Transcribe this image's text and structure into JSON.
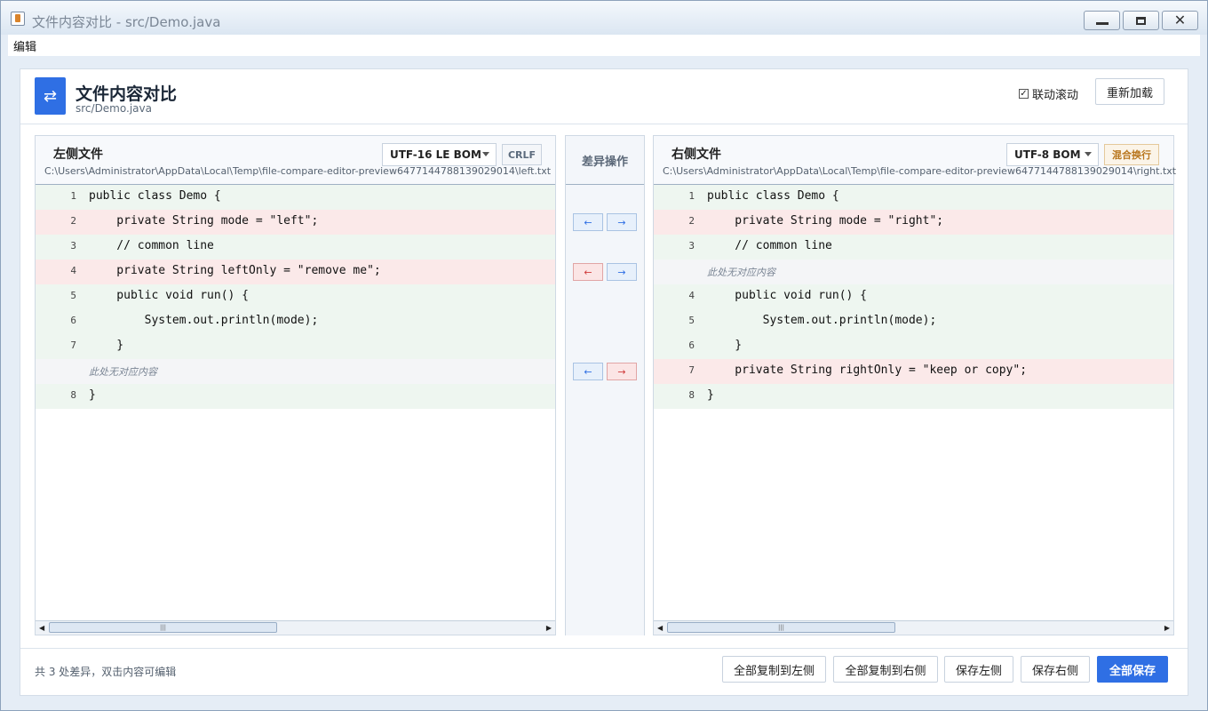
{
  "window": {
    "title": "文件内容对比 - src/Demo.java"
  },
  "menu": {
    "edit": "编辑"
  },
  "header": {
    "icon": "swap-arrows-icon",
    "title": "文件内容对比",
    "subtitle": "src/Demo.java",
    "sync_scroll_label": "联动滚动",
    "sync_scroll_checked": true,
    "reload_label": "重新加载",
    "accent_color": "#2f6fe4"
  },
  "left": {
    "title": "左侧文件",
    "path": "C:\\Users\\Administrator\\AppData\\Local\\Temp\\file-compare-editor-preview6477144788139029014\\left.txt",
    "encoding": "UTF-16 LE BOM",
    "line_ending": "CRLF",
    "lines": [
      {
        "type": "eq",
        "num": "1",
        "text": "public class Demo {"
      },
      {
        "type": "diff",
        "num": "2",
        "text": "    private String mode = \"left\";"
      },
      {
        "type": "eq",
        "num": "3",
        "text": "    // common line"
      },
      {
        "type": "diff",
        "num": "4",
        "text": "    private String leftOnly = \"remove me\";"
      },
      {
        "type": "eq",
        "num": "5",
        "text": "    public void run() {"
      },
      {
        "type": "eq",
        "num": "6",
        "text": "        System.out.println(mode);"
      },
      {
        "type": "eq",
        "num": "7",
        "text": "    }"
      },
      {
        "type": "gap",
        "num": "",
        "text": "此处无对应内容"
      },
      {
        "type": "eq",
        "num": "8",
        "text": "}"
      }
    ]
  },
  "right": {
    "title": "右侧文件",
    "path": "C:\\Users\\Administrator\\AppData\\Local\\Temp\\file-compare-editor-preview6477144788139029014\\right.txt",
    "encoding": "UTF-8 BOM",
    "line_ending": "混合换行",
    "lines": [
      {
        "type": "eq",
        "num": "1",
        "text": "public class Demo {"
      },
      {
        "type": "diff",
        "num": "2",
        "text": "    private String mode = \"right\";"
      },
      {
        "type": "eq",
        "num": "3",
        "text": "    // common line"
      },
      {
        "type": "gap",
        "num": "",
        "text": "此处无对应内容"
      },
      {
        "type": "eq",
        "num": "4",
        "text": "    public void run() {"
      },
      {
        "type": "eq",
        "num": "5",
        "text": "        System.out.println(mode);"
      },
      {
        "type": "eq",
        "num": "6",
        "text": "    }"
      },
      {
        "type": "diff",
        "num": "7",
        "text": "    private String rightOnly = \"keep or copy\";"
      },
      {
        "type": "eq",
        "num": "8",
        "text": "}"
      }
    ]
  },
  "middle": {
    "title": "差异操作",
    "arrow_left": "←",
    "arrow_right": "→",
    "actions": [
      {
        "row": 1,
        "left_highlight": false,
        "right_highlight": false
      },
      {
        "row": 3,
        "left_highlight": true,
        "right_highlight": false
      },
      {
        "row": 7,
        "left_highlight": false,
        "right_highlight": true
      }
    ]
  },
  "footer": {
    "status": "共 3 处差异，双击内容可编辑",
    "copy_all_left": "全部复制到左侧",
    "copy_all_right": "全部复制到右侧",
    "save_left": "保存左侧",
    "save_right": "保存右侧",
    "save_all": "全部保存"
  },
  "colors": {
    "equal_bg": "#eef6f0",
    "diff_bg": "#fbe9e9",
    "gap_bg": "#f4f5f7",
    "primary": "#2f6fe4",
    "danger": "#d03b3b"
  }
}
